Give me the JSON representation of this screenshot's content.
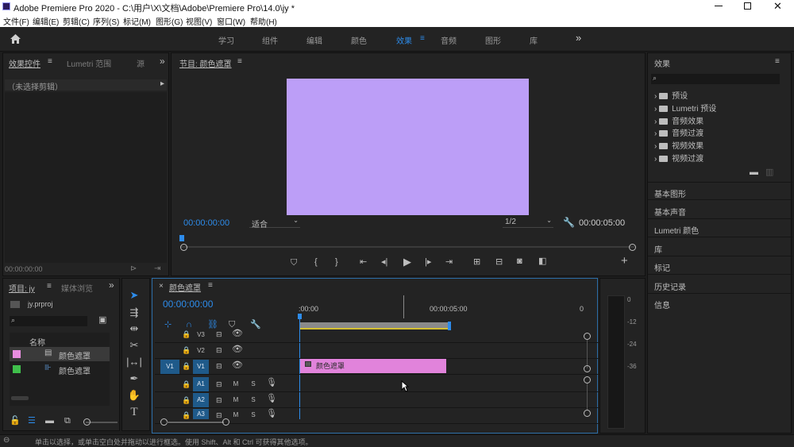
{
  "window": {
    "title": "Adobe Premiere Pro 2020 - C:\\用户\\X\\文档\\Adobe\\Premiere Pro\\14.0\\jy *",
    "controls": [
      "minimize-icon",
      "restore-icon",
      "close-icon"
    ]
  },
  "menu": [
    "文件(F)",
    "编辑(E)",
    "剪辑(C)",
    "序列(S)",
    "标记(M)",
    "图形(G)",
    "视图(V)",
    "窗口(W)",
    "帮助(H)"
  ],
  "workspaces": {
    "tabs": [
      "学习",
      "组件",
      "编辑",
      "颜色",
      "效果",
      "音频",
      "图形",
      "库"
    ],
    "active": "效果",
    "more": "»"
  },
  "effect_controls": {
    "tabs": [
      "效果控件",
      "Lumetri 范围",
      "源"
    ],
    "no_clip": "（未选择剪辑）",
    "timecode": "00:00:00:00"
  },
  "program": {
    "title": "节目: 颜色遮罩",
    "timecode": "00:00:00:00",
    "fit": "适合",
    "resolution": "1/2",
    "duration": "00:00:05:00",
    "preview_color": "#bc9ef7"
  },
  "project": {
    "tabs": [
      "项目: jy",
      "媒体浏览"
    ],
    "filename": "jy.prproj",
    "col_name": "名称",
    "items": [
      {
        "name": "颜色遮罩",
        "swatch": "#e88de0"
      },
      {
        "name": "颜色遮罩",
        "swatch": "#3fbf4b"
      }
    ]
  },
  "timeline": {
    "tab": "颜色遮罩",
    "timecode": "00:00:00:00",
    "ruler": [
      ":00:00",
      "00:00:05:00",
      "0"
    ],
    "video_tracks": [
      "V3",
      "V2",
      "V1"
    ],
    "audio_tracks": [
      "A1",
      "A2",
      "A3"
    ],
    "source_patch": "V1",
    "mute": "M",
    "solo": "S",
    "clip": {
      "name": "颜色遮罩",
      "color": "#e183db"
    }
  },
  "meter": {
    "labels": [
      "0",
      "-12",
      "-24",
      "-36"
    ]
  },
  "effects_panel": {
    "title": "效果",
    "tree": [
      "预设",
      "Lumetri 预设",
      "音频效果",
      "音频过渡",
      "视频效果",
      "视频过渡"
    ],
    "sections": [
      "基本图形",
      "基本声音",
      "Lumetri 颜色",
      "库",
      "标记",
      "历史记录",
      "信息"
    ]
  },
  "status": {
    "text": "单击以选择，或单击空白处并拖动以进行框选。使用 Shift、Alt 和 Ctrl 可获得其他选项。"
  }
}
